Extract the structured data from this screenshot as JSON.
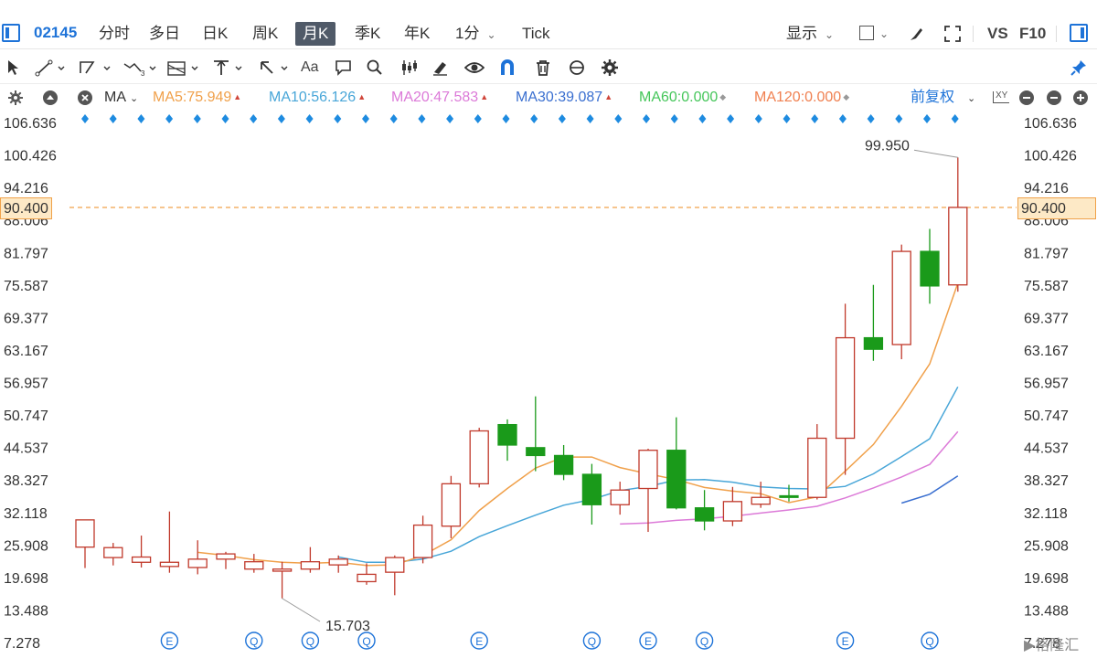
{
  "toolbar": {
    "code": "02145",
    "timeframes": [
      "分时",
      "多日",
      "日K",
      "周K",
      "月K",
      "季K",
      "年K",
      "1分",
      "Tick"
    ],
    "active_timeframe": "月K",
    "display_label": "显示",
    "vs_label": "VS",
    "f10_label": "F10"
  },
  "ma_bar": {
    "ma_label": "MA",
    "ma5": "MA5:75.949",
    "ma10": "MA10:56.126",
    "ma20": "MA20:47.583",
    "ma30": "MA30:39.087",
    "ma60": "MA60:0.000",
    "ma120": "MA120:0.000",
    "adjust_label": "前复权",
    "xy_label": "XY"
  },
  "colors": {
    "up": "#c0392b",
    "down": "#1a9a1a",
    "ma5": "#f0a04a",
    "ma10": "#48a6d8",
    "ma20": "#dc7ad8",
    "ma30": "#3a6fd0",
    "ma60": "#45c65a",
    "ma120": "#f08050",
    "accent": "#1e73d8"
  },
  "axis": {
    "ticks": [
      "106.636",
      "100.426",
      "94.216",
      "88.006",
      "81.797",
      "75.587",
      "69.377",
      "63.167",
      "56.957",
      "50.747",
      "44.537",
      "38.327",
      "32.118",
      "25.908",
      "19.698",
      "13.488",
      "7.278"
    ],
    "current_price": "90.400",
    "max_label": "99.950",
    "min_label": "15.703"
  },
  "chart_data": {
    "type": "candlestick",
    "ylim": [
      7.278,
      106.636
    ],
    "candles": [
      {
        "o": 25.5,
        "c": 30.7,
        "h": 30.7,
        "l": 21.5
      },
      {
        "o": 23.5,
        "c": 25.4,
        "h": 26.3,
        "l": 22.0
      },
      {
        "o": 22.6,
        "c": 23.6,
        "h": 27.7,
        "l": 21.6
      },
      {
        "o": 21.8,
        "c": 22.6,
        "h": 32.3,
        "l": 20.6
      },
      {
        "o": 21.6,
        "c": 23.2,
        "h": 26.8,
        "l": 20.3
      },
      {
        "o": 23.2,
        "c": 24.2,
        "h": 24.6,
        "l": 21.3
      },
      {
        "o": 21.3,
        "c": 22.7,
        "h": 24.2,
        "l": 20.6
      },
      {
        "o": 20.9,
        "c": 21.3,
        "h": 22.7,
        "l": 15.703
      },
      {
        "o": 21.3,
        "c": 22.7,
        "h": 25.5,
        "l": 20.6
      },
      {
        "o": 22.1,
        "c": 23.2,
        "h": 23.9,
        "l": 20.6
      },
      {
        "o": 18.9,
        "c": 20.3,
        "h": 22.4,
        "l": 18.3
      },
      {
        "o": 20.7,
        "c": 23.5,
        "h": 23.9,
        "l": 16.3
      },
      {
        "o": 23.5,
        "c": 29.7,
        "h": 31.5,
        "l": 22.4
      },
      {
        "o": 29.5,
        "c": 37.6,
        "h": 39.1,
        "l": 27.2
      },
      {
        "o": 37.6,
        "c": 47.7,
        "h": 48.3,
        "l": 36.9
      },
      {
        "o": 48.9,
        "c": 45.0,
        "h": 49.9,
        "l": 42.0
      },
      {
        "o": 44.5,
        "c": 43.0,
        "h": 54.3,
        "l": 40.0
      },
      {
        "o": 43.0,
        "c": 39.4,
        "h": 45.0,
        "l": 38.3
      },
      {
        "o": 39.4,
        "c": 33.6,
        "h": 41.4,
        "l": 29.8
      },
      {
        "o": 33.6,
        "c": 36.4,
        "h": 38.0,
        "l": 31.7
      },
      {
        "o": 36.7,
        "c": 44.0,
        "h": 44.3,
        "l": 28.4
      },
      {
        "o": 44.0,
        "c": 33.0,
        "h": 50.3,
        "l": 32.7
      },
      {
        "o": 33.0,
        "c": 30.5,
        "h": 36.4,
        "l": 28.7
      },
      {
        "o": 30.5,
        "c": 34.2,
        "h": 37.0,
        "l": 29.5
      },
      {
        "o": 33.7,
        "c": 35.0,
        "h": 38.0,
        "l": 33.0
      },
      {
        "o": 35.3,
        "c": 35.0,
        "h": 37.4,
        "l": 34.2
      },
      {
        "o": 35.0,
        "c": 46.3,
        "h": 49.0,
        "l": 34.6
      },
      {
        "o": 46.3,
        "c": 65.5,
        "h": 72.0,
        "l": 39.3
      },
      {
        "o": 65.5,
        "c": 63.3,
        "h": 75.6,
        "l": 61.1
      },
      {
        "o": 64.2,
        "c": 82.0,
        "h": 83.3,
        "l": 61.4
      },
      {
        "o": 82.0,
        "c": 75.4,
        "h": 86.3,
        "l": 72.0
      },
      {
        "o": 75.6,
        "c": 90.4,
        "h": 99.95,
        "l": 74.3
      }
    ],
    "ma5": [
      null,
      null,
      null,
      null,
      24.5,
      23.9,
      23.1,
      22.6,
      22.4,
      22.6,
      22.0,
      22.1,
      23.9,
      26.9,
      32.5,
      36.7,
      40.6,
      42.7,
      42.7,
      40.7,
      39.5,
      38.4,
      36.9,
      36.2,
      35.7,
      34.0,
      35.1,
      40.0,
      45.1,
      52.4,
      60.5,
      75.949
    ],
    "ma10": [
      null,
      null,
      null,
      null,
      null,
      null,
      null,
      null,
      null,
      23.6,
      22.6,
      22.6,
      23.2,
      24.7,
      27.5,
      29.6,
      31.6,
      33.5,
      34.6,
      36.3,
      37.1,
      38.3,
      38.4,
      37.9,
      37.0,
      36.7,
      36.6,
      37.1,
      39.5,
      42.8,
      46.2,
      56.126
    ],
    "ma20": [
      null,
      null,
      null,
      null,
      null,
      null,
      null,
      null,
      null,
      null,
      null,
      null,
      null,
      null,
      null,
      null,
      null,
      null,
      null,
      29.9,
      30.1,
      30.6,
      30.9,
      31.4,
      32.0,
      32.6,
      33.3,
      34.9,
      36.8,
      38.9,
      41.3,
      47.583
    ],
    "ma30": [
      null,
      null,
      null,
      null,
      null,
      null,
      null,
      null,
      null,
      null,
      null,
      null,
      null,
      null,
      null,
      null,
      null,
      null,
      null,
      null,
      null,
      null,
      null,
      null,
      null,
      null,
      null,
      null,
      null,
      33.9,
      35.6,
      39.087
    ],
    "events": [
      {
        "index": 3,
        "label": "E"
      },
      {
        "index": 6,
        "label": "Q"
      },
      {
        "index": 8,
        "label": "Q"
      },
      {
        "index": 10,
        "label": "Q"
      },
      {
        "index": 14,
        "label": "E"
      },
      {
        "index": 18,
        "label": "Q"
      },
      {
        "index": 20,
        "label": "E"
      },
      {
        "index": 22,
        "label": "Q"
      },
      {
        "index": 27,
        "label": "E"
      },
      {
        "index": 30,
        "label": "Q"
      }
    ]
  }
}
